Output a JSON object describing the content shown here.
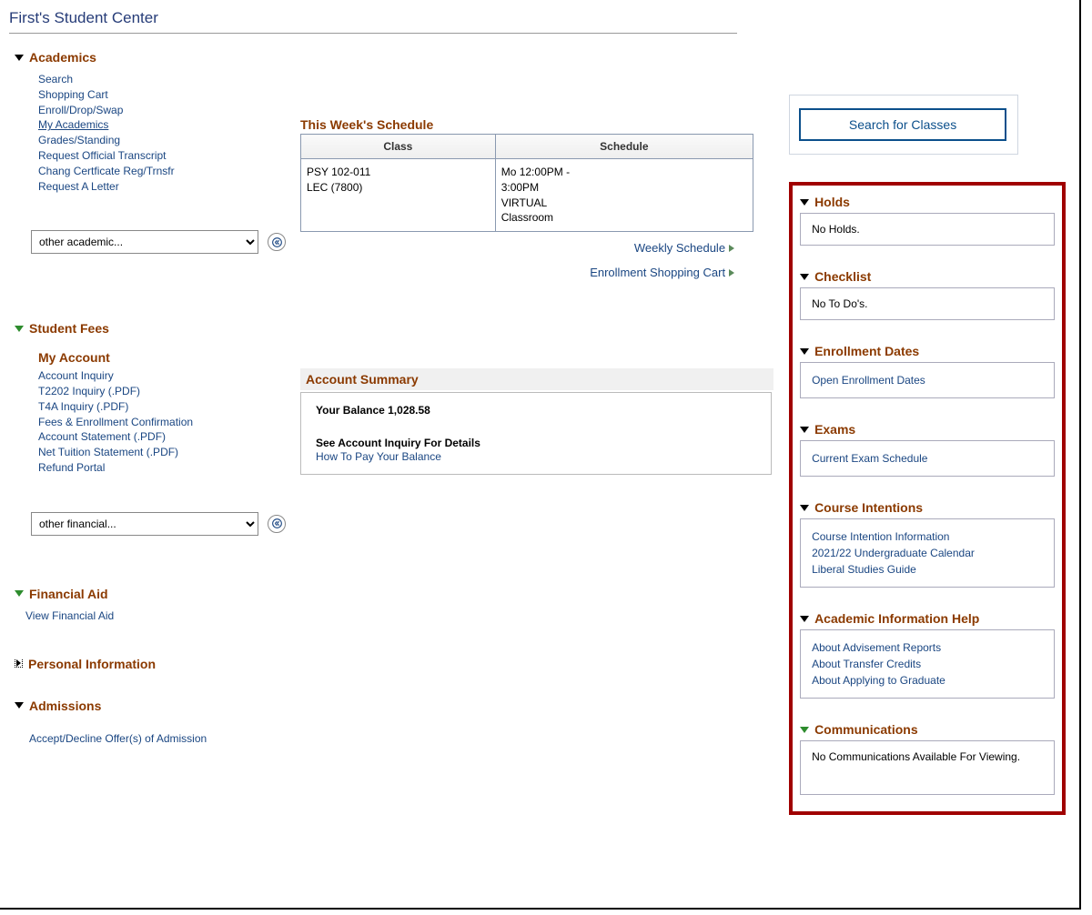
{
  "page_title": "First's Student Center",
  "search_classes_label": "Search for Classes",
  "academics": {
    "title": "Academics",
    "links": {
      "search": "Search",
      "shopping_cart": "Shopping Cart",
      "enroll_drop_swap": "Enroll/Drop/Swap",
      "my_academics": "My Academics",
      "grades_standing": "Grades/Standing",
      "request_transcript": "Request Official Transcript",
      "chang_cert": "Chang Certficate Reg/Trnsfr",
      "request_letter": "Request A Letter"
    },
    "select_value": "other academic...",
    "schedule": {
      "title": "This Week's Schedule",
      "col_class": "Class",
      "col_schedule": "Schedule",
      "class_val_line1": "PSY 102-011",
      "class_val_line2": "LEC (7800)",
      "sched_val_line1": "Mo 12:00PM -",
      "sched_val_line2": "3:00PM",
      "sched_val_line3": "VIRTUAL",
      "sched_val_line4": "Classroom",
      "weekly_schedule_link": "Weekly Schedule",
      "shopping_cart_link": "Enrollment Shopping Cart"
    }
  },
  "student_fees": {
    "title": "Student Fees",
    "my_account": "My Account",
    "links": {
      "account_inquiry": "Account Inquiry",
      "t2202": "T2202 Inquiry (.PDF)",
      "t4a": "T4A Inquiry (.PDF)",
      "fees_enroll": "Fees & Enrollment Confirmation",
      "account_statement": "Account Statement (.PDF)",
      "net_tuition": "Net Tuition Statement (.PDF)",
      "refund_portal": "Refund Portal"
    },
    "select_value": "other financial...",
    "summary": {
      "title": "Account Summary",
      "balance_label": "Your Balance 1,028.58",
      "detail_text": "See Account Inquiry For Details",
      "pay_link": "How To Pay Your Balance"
    }
  },
  "financial_aid": {
    "title": "Financial Aid",
    "view_link": "View Financial Aid"
  },
  "personal_info": {
    "title": "Personal Information"
  },
  "admissions": {
    "title": "Admissions",
    "accept_decline": "Accept/Decline Offer(s) of Admission"
  },
  "sidebar": {
    "holds": {
      "title": "Holds",
      "content": "No Holds."
    },
    "checklist": {
      "title": "Checklist",
      "content": "No To Do's."
    },
    "enrollment_dates": {
      "title": "Enrollment Dates",
      "link": "Open Enrollment Dates"
    },
    "exams": {
      "title": "Exams",
      "link": "Current Exam Schedule"
    },
    "course_intentions": {
      "title": "Course Intentions",
      "link1": "Course Intention Information",
      "link2": "2021/22 Undergraduate Calendar",
      "link3": "Liberal Studies Guide"
    },
    "academic_help": {
      "title": "Academic Information Help",
      "link1": "About Advisement Reports",
      "link2": "About Transfer Credits",
      "link3": "About Applying to Graduate"
    },
    "communications": {
      "title": "Communications",
      "content": "No Communications Available For Viewing."
    }
  }
}
